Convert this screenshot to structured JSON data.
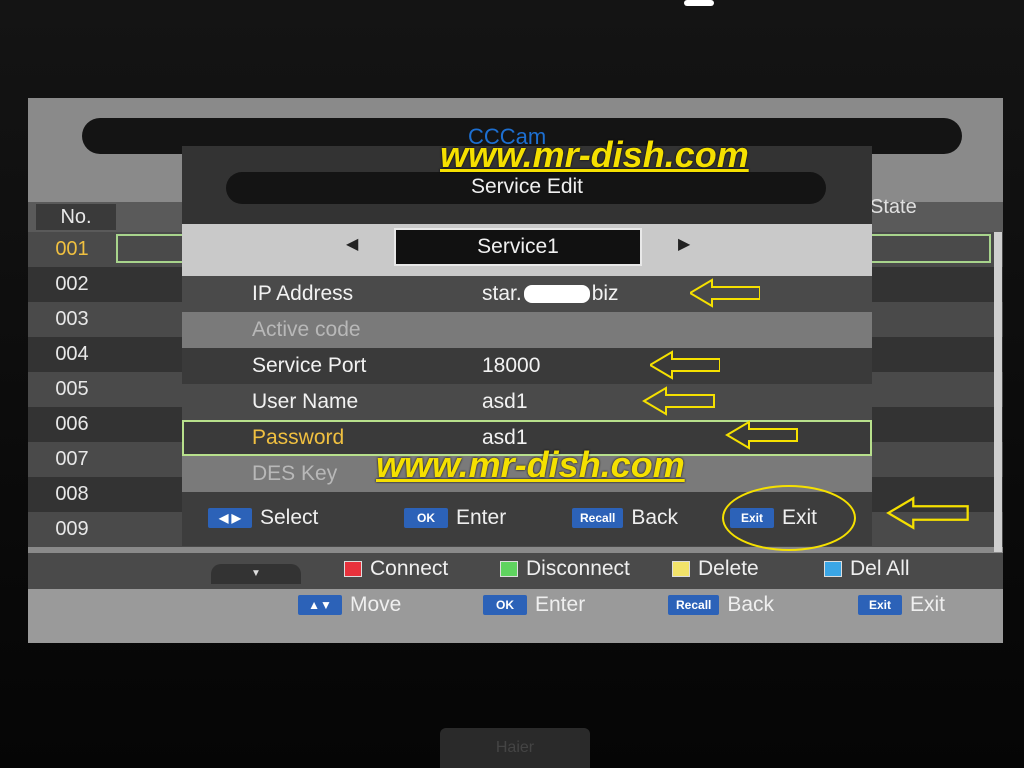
{
  "app_title": "CCCam",
  "list_header": {
    "no": "No.",
    "state": "State"
  },
  "rows": [
    "001",
    "002",
    "003",
    "004",
    "005",
    "006",
    "007",
    "008",
    "009"
  ],
  "color_keys": [
    {
      "label": "Connect",
      "color": "#e8323c"
    },
    {
      "label": "Disconnect",
      "color": "#5fd35f"
    },
    {
      "label": "Delete",
      "color": "#f2e36a"
    },
    {
      "label": "Del All",
      "color": "#3aa6e6"
    }
  ],
  "nav_keys": [
    {
      "tag": "▲▼",
      "label": "Move"
    },
    {
      "tag": "OK",
      "label": "Enter"
    },
    {
      "tag": "Recall",
      "label": "Back"
    },
    {
      "tag": "Exit",
      "label": "Exit"
    }
  ],
  "dialog": {
    "title": "Service Edit",
    "service": "Service1",
    "fields": [
      {
        "label": "IP Address",
        "value": "star.",
        "value_suffix": "biz"
      },
      {
        "label": "Active code",
        "value": ""
      },
      {
        "label": "Service Port",
        "value": "18000"
      },
      {
        "label": "User Name",
        "value": "asd1"
      },
      {
        "label": "Password",
        "value": "asd1"
      },
      {
        "label": "DES Key",
        "value": ""
      }
    ],
    "keys": [
      {
        "tag": "◀ ▶",
        "label": "Select"
      },
      {
        "tag": "OK",
        "label": "Enter"
      },
      {
        "tag": "Recall",
        "label": "Back"
      },
      {
        "tag": "Exit",
        "label": "Exit"
      }
    ]
  },
  "watermarks": [
    "www.mr-dish.com",
    "www.mr-dish.com"
  ],
  "brand": "Haier",
  "colors": {
    "annotation": "#f5e000",
    "selection": "#b8e08c",
    "highlight_text": "#f0c040",
    "key_tag": "#2c62b8"
  }
}
